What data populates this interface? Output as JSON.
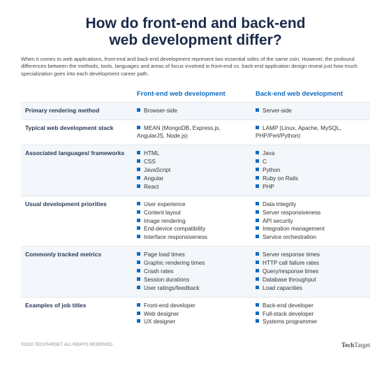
{
  "title_line1": "How do front-end and back-end",
  "title_line2": "web development differ?",
  "intro": "When it comes to web applications, front-end and back-end development represent two essential sides of the same coin. However, the profound differences between the methods, tools, languages and areas of focus involved in front-end vs. back-end application design reveal just how much specialization goes into each development career path.",
  "headers": {
    "frontend": "Front-end web development",
    "backend": "Back-end web development"
  },
  "rows": [
    {
      "label": "Primary rendering method",
      "frontend": [
        "Browser-side"
      ],
      "backend": [
        "Server-side"
      ]
    },
    {
      "label": "Typical web development stack",
      "frontend": [
        "MEAN (MongoDB, Express.js, AngularJS, Node.js)"
      ],
      "backend": [
        "LAMP (Linux, Apache, MySQL, PHP/Perl/Python)"
      ]
    },
    {
      "label": "Associated languages/ frameworks",
      "frontend": [
        "HTML",
        "CSS",
        "JavaScript",
        "Angular",
        "React"
      ],
      "backend": [
        "Java",
        "C",
        "Python",
        "Ruby on Rails",
        "PHP"
      ]
    },
    {
      "label": "Usual development priorities",
      "frontend": [
        "User experience",
        "Content layout",
        "Image rendering",
        "End-device compatibility",
        "Interface responsiveness"
      ],
      "backend": [
        "Data integrity",
        "Server responsiveness",
        "API security",
        "Integration management",
        "Service orchestration"
      ]
    },
    {
      "label": "Commonly tracked metrics",
      "frontend": [
        "Page load times",
        "Graphic rendering times",
        "Crash rates",
        "Session durations",
        "User ratings/feedback"
      ],
      "backend": [
        "Server response times",
        "HTTP call failure rates",
        "Query/response times",
        "Database throughput",
        "Load capacities"
      ]
    },
    {
      "label": "Examples of job titles",
      "frontend": [
        "Front-end developer",
        "Web designer",
        "UX designer"
      ],
      "backend": [
        "Back-end developer",
        "Full-stack developer",
        "Systems programmer"
      ]
    }
  ],
  "footer": {
    "copyright": "©2022 TECHTARGET. ALL RIGHTS RESERVED",
    "brand_left": "Tech",
    "brand_right": "Target"
  }
}
